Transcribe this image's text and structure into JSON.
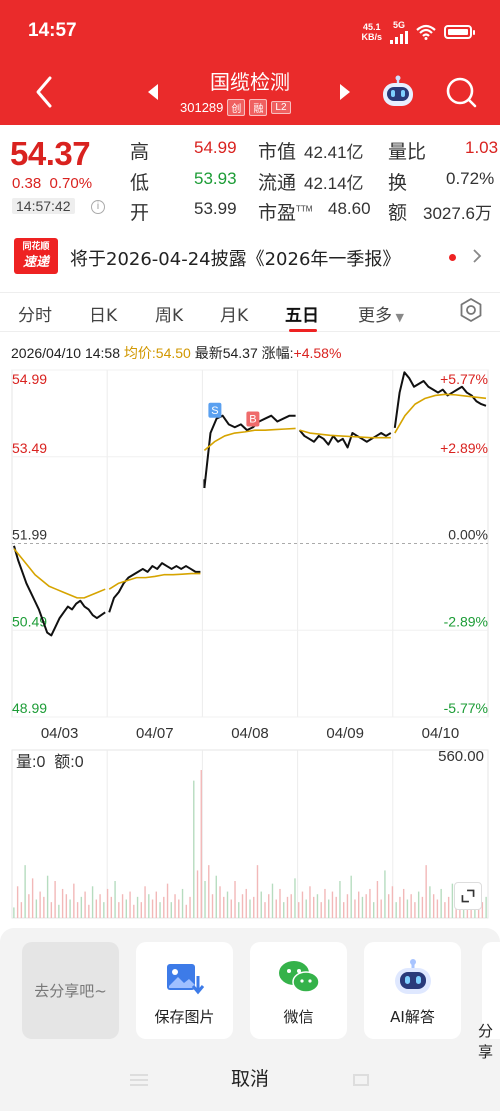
{
  "status": {
    "time": "14:57",
    "net_speed_value": "45.1",
    "net_speed_unit": "KB/s",
    "signal": "5G"
  },
  "header": {
    "stock_name": "国缆检测",
    "stock_code": "301289",
    "tags": [
      "创",
      "融",
      "L2"
    ]
  },
  "quote": {
    "price": "54.37",
    "change": "0.38",
    "change_pct": "0.70%",
    "time": "14:57:42",
    "high_label": "高",
    "high": "54.99",
    "low_label": "低",
    "low": "53.93",
    "open_label": "开",
    "open": "53.99",
    "mktcap_label": "市值",
    "mktcap": "42.41亿",
    "float_label": "流通",
    "float": "42.14亿",
    "pe_label": "市盈",
    "pe_sup": "TTM",
    "pe": "48.60",
    "vol_ratio_label": "量比",
    "vol_ratio": "1.03",
    "turnover_label": "换",
    "turnover": "0.72%",
    "amount_label": "额",
    "amount": "3027.6万"
  },
  "banner": {
    "logo_top": "同花顺",
    "logo_bottom": "速递",
    "text": "将于2026-04-24披露《2026年一季报》"
  },
  "tabs": [
    "分时",
    "日K",
    "周K",
    "月K",
    "五日",
    "更多"
  ],
  "active_tab": "五日",
  "chart_info": {
    "datetime": "2026/04/10 14:58",
    "avg_label": "均价:54.50",
    "latest_label": "最新54.37",
    "pct_label": "涨幅:",
    "pct_value": "+4.58%"
  },
  "chart_data": {
    "type": "line",
    "y_left_ticks": [
      "54.99",
      "53.49",
      "51.99",
      "50.49",
      "48.99"
    ],
    "y_right_ticks": [
      "+5.77%",
      "+2.89%",
      "0.00%",
      "-2.89%",
      "-5.77%"
    ],
    "x_labels": [
      "04/03",
      "04/07",
      "04/08",
      "04/09",
      "04/10"
    ],
    "ylim": [
      48.99,
      54.99
    ],
    "prev_close": 51.99,
    "markers": [
      "S",
      "B"
    ],
    "series": [
      {
        "name": "price",
        "segments": [
          {
            "day": 0,
            "values": [
              51.95,
              51.7,
              51.5,
              51.3,
              51.15,
              51.0,
              50.85,
              50.65,
              50.45,
              50.4,
              50.55,
              50.7,
              50.8,
              50.9,
              50.85,
              50.95,
              51.0,
              50.9,
              50.85,
              50.75,
              50.7,
              50.75,
              50.8
            ]
          },
          {
            "day": 1,
            "values": [
              50.8,
              51.05,
              51.15,
              51.3,
              51.4,
              51.45,
              51.5,
              51.55,
              51.5,
              51.6,
              51.55,
              51.65,
              51.6,
              51.55,
              51.6,
              51.55,
              51.6,
              51.55,
              51.5,
              51.5
            ]
          },
          {
            "day": 2,
            "values": [
              52.95,
              53.9,
              54.15,
              54.2,
              54.05,
              54.0,
              54.05,
              53.95,
              54.0,
              54.1,
              54.15,
              54.2,
              54.1,
              54.15,
              54.2,
              54.2
            ]
          },
          {
            "day": 3,
            "values": [
              53.95,
              53.85,
              53.8,
              53.75,
              53.85,
              53.8,
              53.7,
              53.85,
              53.75,
              53.8,
              53.65,
              53.9,
              53.85,
              53.8,
              53.75,
              53.8,
              53.85,
              53.9,
              53.85,
              53.9
            ]
          },
          {
            "day": 4,
            "values": [
              53.99,
              54.6,
              54.95,
              54.85,
              54.7,
              54.75,
              54.8,
              54.7,
              54.65,
              54.6,
              54.65,
              54.55,
              54.6,
              54.65,
              54.7,
              54.6,
              54.55,
              54.45,
              54.4,
              54.37
            ]
          }
        ]
      },
      {
        "name": "avg",
        "segments": [
          {
            "day": 0,
            "values": [
              51.9,
              51.75,
              51.6,
              51.45,
              51.35,
              51.25,
              51.2,
              51.15,
              51.1,
              51.05,
              51.05,
              51.1,
              51.15,
              51.2
            ]
          },
          {
            "day": 1,
            "values": [
              51.2,
              51.3,
              51.35,
              51.4,
              51.4,
              51.42,
              51.45,
              51.45,
              51.46,
              51.47,
              51.47
            ]
          },
          {
            "day": 2,
            "values": [
              53.6,
              53.75,
              53.85,
              53.9,
              53.92,
              53.95,
              53.95,
              53.96,
              53.97,
              53.98
            ]
          },
          {
            "day": 3,
            "values": [
              53.95,
              53.9,
              53.88,
              53.86,
              53.85,
              53.84,
              53.83,
              53.82,
              53.82,
              53.82
            ]
          },
          {
            "day": 4,
            "values": [
              53.9,
              54.2,
              54.4,
              54.5,
              54.55,
              54.57,
              54.56,
              54.54,
              54.52,
              54.5
            ]
          }
        ]
      }
    ]
  },
  "volume": {
    "label_vol": "量:0",
    "label_amt": "额:0",
    "max_label": "560.00",
    "max": 560,
    "bars": [
      40,
      120,
      60,
      200,
      90,
      150,
      70,
      100,
      80,
      160,
      60,
      140,
      50,
      110,
      90,
      70,
      130,
      60,
      80,
      100,
      50,
      120,
      70,
      90,
      60,
      110,
      80,
      140,
      60,
      90,
      70,
      100,
      50,
      80,
      60,
      120,
      90,
      70,
      100,
      60,
      80,
      130,
      60,
      90,
      70,
      110,
      50,
      80,
      520,
      180,
      560,
      140,
      200,
      90,
      160,
      120,
      80,
      100,
      70,
      140,
      60,
      90,
      110,
      70,
      80,
      200,
      100,
      60,
      90,
      130,
      70,
      110,
      60,
      80,
      90,
      150,
      60,
      100,
      70,
      120,
      80,
      90,
      60,
      110,
      70,
      100,
      80,
      140,
      60,
      90,
      160,
      70,
      100,
      80,
      90,
      110,
      60,
      140,
      70,
      180,
      90,
      120,
      60,
      80,
      110,
      70,
      90,
      60,
      100,
      80,
      200,
      120,
      90,
      70,
      110,
      60,
      80,
      130,
      90,
      70,
      60,
      90,
      80,
      100,
      70,
      60,
      80
    ]
  },
  "share_sheet": {
    "items": [
      "去分享吧~",
      "保存图片",
      "微信",
      "AI解答",
      "分享"
    ],
    "cancel": "取消"
  },
  "colors": {
    "brand_red": "#ea2b2b",
    "up": "#d9221f",
    "down": "#1c9c36",
    "avg_line": "#d6a400"
  }
}
